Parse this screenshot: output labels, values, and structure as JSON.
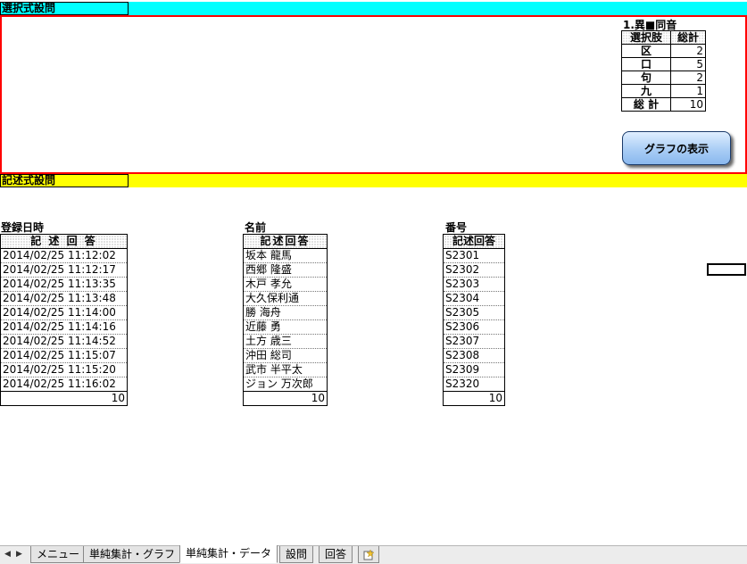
{
  "sections": {
    "choice_title": "選択式設問",
    "free_title": "記述式設問"
  },
  "choice": {
    "question_title": "1.異■同音",
    "headers": [
      "選択肢",
      "総計"
    ],
    "rows": [
      {
        "option": "区",
        "count": "2"
      },
      {
        "option": "口",
        "count": "5"
      },
      {
        "option": "句",
        "count": "2"
      },
      {
        "option": "九",
        "count": "1"
      }
    ],
    "total_label": "総 計",
    "total": "10",
    "graph_button": "グラフの表示"
  },
  "columns": {
    "date": {
      "title": "登録日時",
      "header": "記 述 回 答",
      "values": [
        "2014/02/25 11:12:02",
        "2014/02/25 11:12:17",
        "2014/02/25 11:13:35",
        "2014/02/25 11:13:48",
        "2014/02/25 11:14:00",
        "2014/02/25 11:14:16",
        "2014/02/25 11:14:52",
        "2014/02/25 11:15:07",
        "2014/02/25 11:15:20",
        "2014/02/25 11:16:02"
      ],
      "total": "10"
    },
    "name": {
      "title": "名前",
      "header": "記述回答",
      "values": [
        "坂本 龍馬",
        "西郷 隆盛",
        "木戸 孝允",
        "大久保利通",
        "勝 海舟",
        "近藤 勇",
        "土方 歳三",
        "沖田 総司",
        "武市 半平太",
        "ジョン 万次郎"
      ],
      "total": "10"
    },
    "number": {
      "title": "番号",
      "header": "記述回答",
      "values": [
        "S2301",
        "S2302",
        "S2303",
        "S2304",
        "S2305",
        "S2306",
        "S2307",
        "S2308",
        "S2309",
        "S2320"
      ],
      "total": "10"
    }
  },
  "tabs": {
    "nav_first": "◀",
    "nav_last": "▶",
    "items": [
      "メニュー",
      "単純集計・グラフ",
      "単純集計・データ",
      "設問",
      "回答"
    ],
    "active_index": 2
  }
}
